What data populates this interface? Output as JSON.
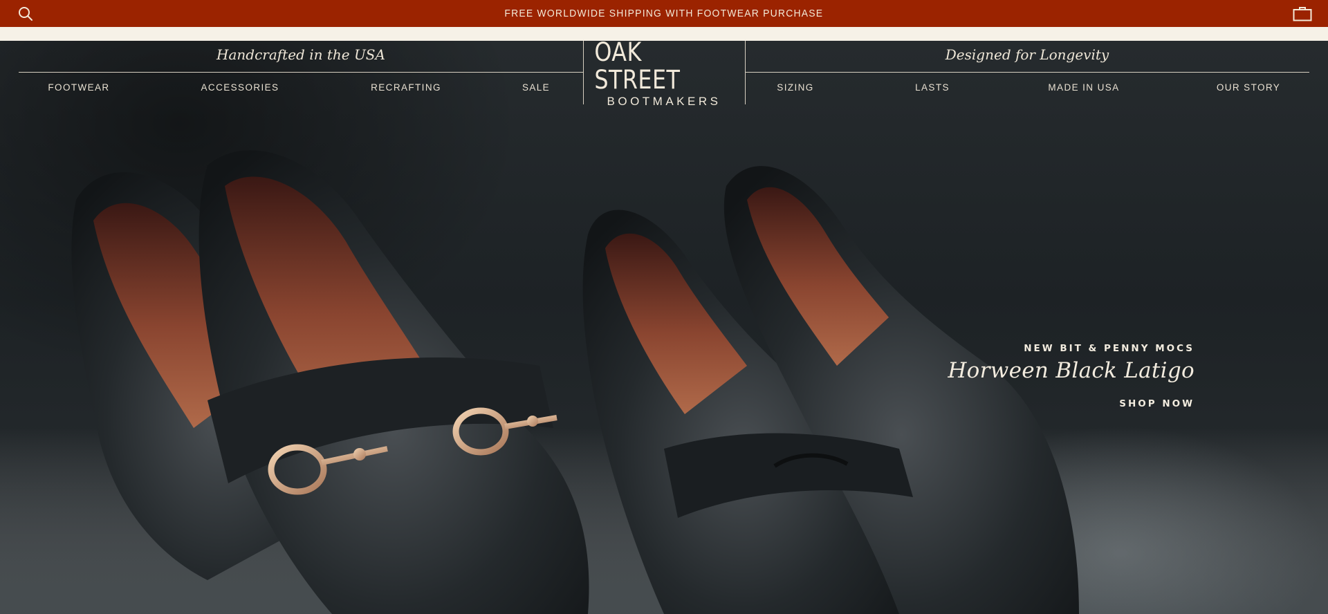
{
  "colors": {
    "announcement_bg": "#9b2300",
    "cream": "#f6f1e7",
    "text_light": "#f1e9da"
  },
  "announcement": {
    "message": "FREE WORLDWIDE SHIPPING WITH FOOTWEAR PURCHASE",
    "left_icon": "search-icon",
    "right_icon": "shopping-bag-icon"
  },
  "header": {
    "tagline_left": "Handcrafted in the USA",
    "tagline_right": "Designed for Longevity",
    "logo": {
      "line1": "OAK STREET",
      "line2": "BOOTMAKERS"
    },
    "nav_left": [
      "FOOTWEAR",
      "ACCESSORIES",
      "RECRAFTING",
      "SALE"
    ],
    "nav_right": [
      "SIZING",
      "LASTS",
      "MADE IN USA",
      "OUR STORY"
    ]
  },
  "hero": {
    "eyebrow": "NEW BIT & PENNY MOCS",
    "headline": "Horween Black Latigo",
    "cta": "SHOP NOW"
  }
}
